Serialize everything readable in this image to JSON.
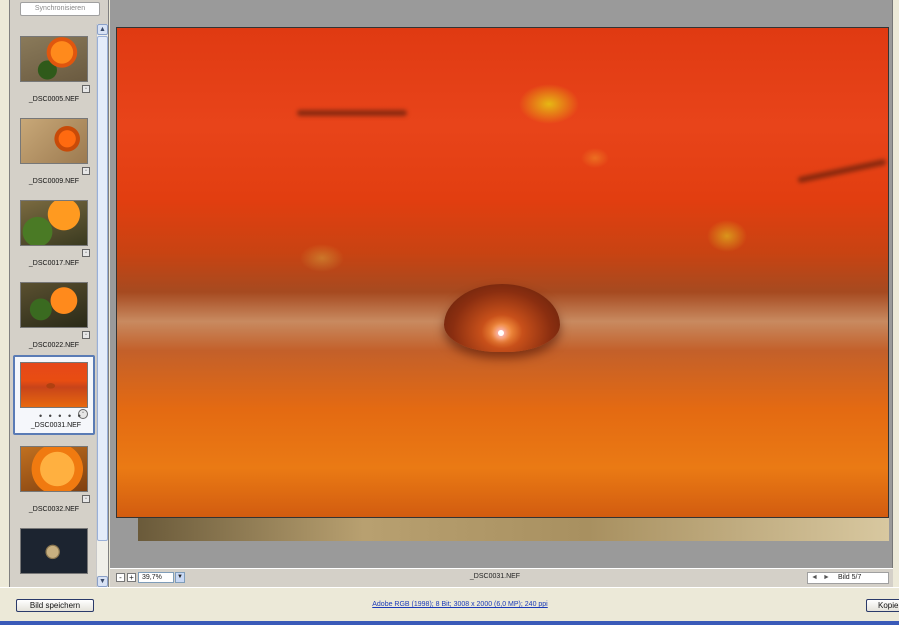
{
  "filmstrip": {
    "sync_label": "Synchronisieren",
    "thumbnails": [
      {
        "filename": "_DSC0005.NEF",
        "art": "t-flower1",
        "selected": false
      },
      {
        "filename": "_DSC0009.NEF",
        "art": "t-flower2",
        "selected": false
      },
      {
        "filename": "_DSC0017.NEF",
        "art": "t-flower3",
        "selected": false
      },
      {
        "filename": "_DSC0022.NEF",
        "art": "t-flower4",
        "selected": false
      },
      {
        "filename": "_DSC0031.NEF",
        "art": "t-drop",
        "selected": true,
        "rating_dots": "• • • • •"
      },
      {
        "filename": "_DSC0032.NEF",
        "art": "t-flower5",
        "selected": false
      },
      {
        "filename": "",
        "art": "t-moon",
        "selected": false
      }
    ]
  },
  "viewer": {
    "zoom_value": "39,7%",
    "zoom_out_symbol": "-",
    "zoom_in_symbol": "+",
    "current_filename": "_DSC0031.NEF",
    "image_position": "Bild 5/7"
  },
  "bottom": {
    "save_label": "Bild speichern",
    "workflow_options": "Adobe RGB (1998); 8 Bit; 3008 x 2000 (6,0 MP); 240 ppi",
    "copy_label": "Kopie"
  },
  "colors": {
    "selection_border": "#5a7bb5",
    "link_blue": "#1a3ab8",
    "window_frame": "#3a5ab8"
  }
}
